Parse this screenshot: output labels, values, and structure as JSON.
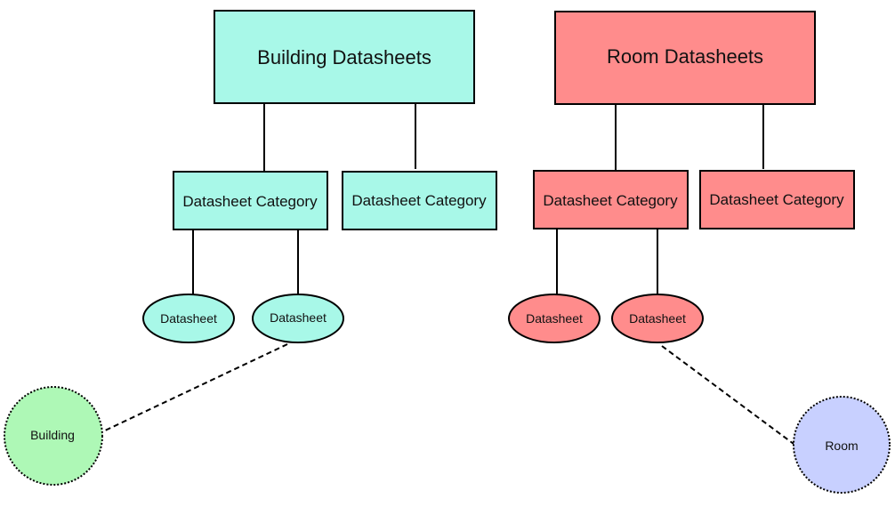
{
  "colors": {
    "building": "#a8f8e8",
    "room": "#ff8c8c",
    "building_entity": "#aef8b6",
    "room_entity": "#c8d0ff",
    "stroke": "#000000"
  },
  "building": {
    "root": "Building Datasheets",
    "categories": [
      "Datasheet Category",
      "Datasheet Category"
    ],
    "datasheets": [
      "Datasheet",
      "Datasheet"
    ],
    "entity": "Building"
  },
  "room": {
    "root": "Room Datasheets",
    "categories": [
      "Datasheet Category",
      "Datasheet Category"
    ],
    "datasheets": [
      "Datasheet",
      "Datasheet"
    ],
    "entity": "Room"
  }
}
